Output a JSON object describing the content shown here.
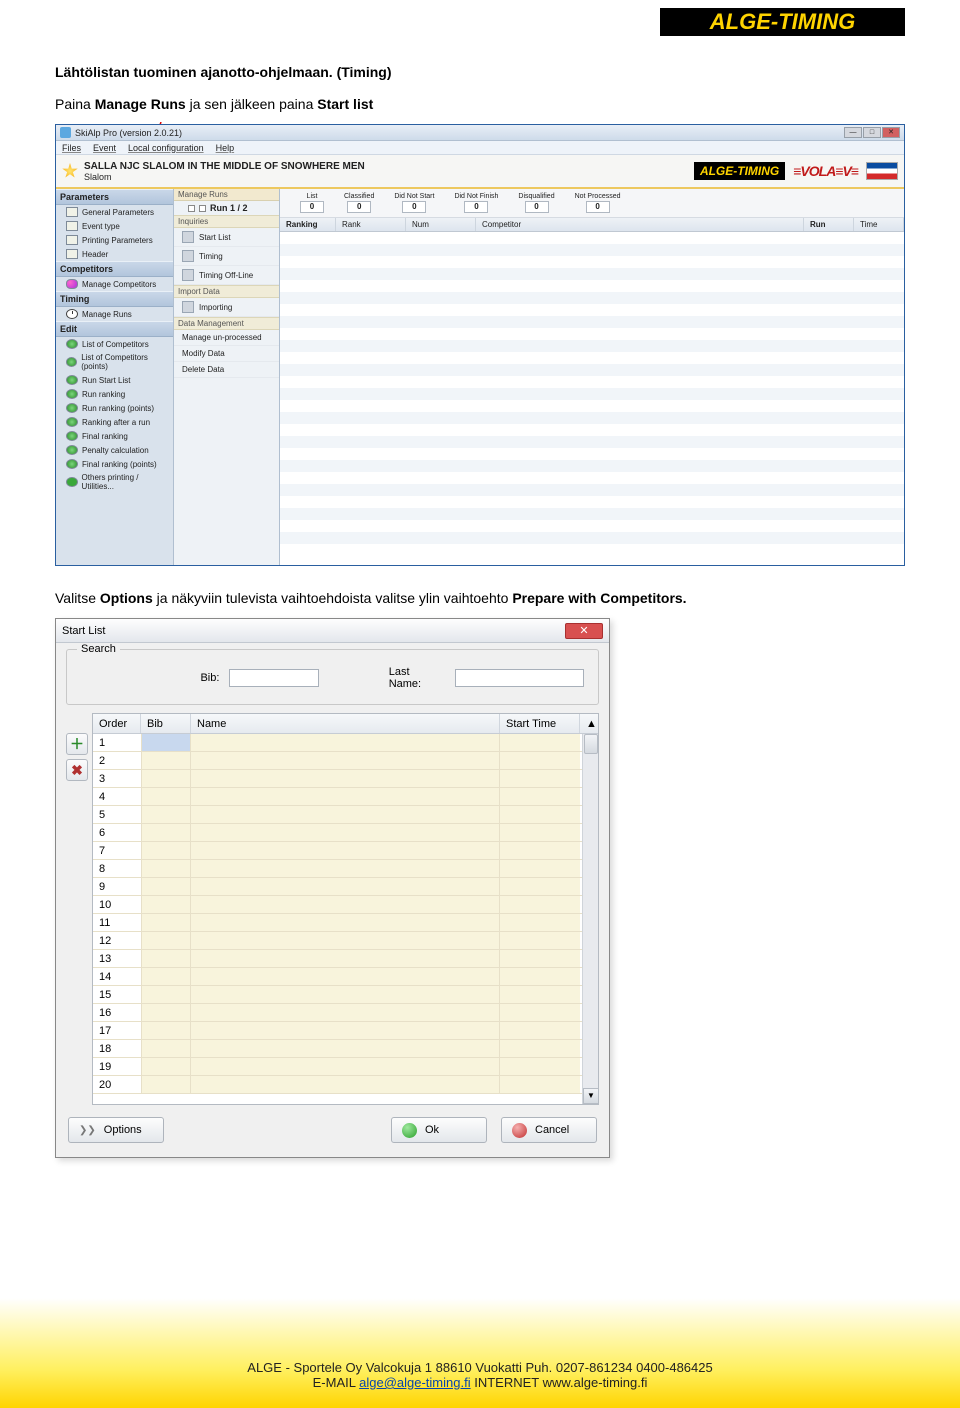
{
  "logo_text": "ALGE-TIMING",
  "heading": "Lähtölistan tuominen ajanotto-ohjelmaan. (Timing)",
  "para2_pre": "Paina ",
  "para2_b1": "Manage Runs",
  "para2_mid": " ja sen jälkeen paina ",
  "para2_b2": "Start list",
  "para3_pre": "Valitse ",
  "para3_b1": "Options",
  "para3_mid": " ja näkyviin tulevista vaihtoehdoista valitse ylin vaihtoehto ",
  "para3_b2": "Prepare with Competitors.",
  "app1": {
    "title": "SkiAlp Pro (version 2.0.21)",
    "menus": [
      "Files",
      "Event",
      "Local configuration",
      "Help"
    ],
    "event_title": "SALLA NJC SLALOM IN THE MIDDLE OF SNOWHERE MEN",
    "event_sub": "Slalom",
    "logo1": "ALGE-TIMING",
    "logo2": "≡VOLA≡V≡",
    "sidebar": {
      "parameters": "Parameters",
      "p_items": [
        "General Parameters",
        "Event type",
        "Printing Parameters",
        "Header"
      ],
      "competitors": "Competitors",
      "c_items": [
        "Manage Competitors"
      ],
      "timing": "Timing",
      "t_items": [
        "Manage Runs"
      ],
      "edit": "Edit",
      "e_items": [
        "List of Competitors",
        "List of Competitors (points)",
        "Run Start List",
        "Run ranking",
        "Run ranking (points)",
        "Ranking after a run",
        "Final ranking",
        "Penalty calculation",
        "Final ranking (points)",
        "Others printing / Utilities..."
      ]
    },
    "center": {
      "head": "Manage Runs",
      "run": "Run 1 / 2",
      "cat1": "Inquiries",
      "i1": "Start List",
      "i2": "Timing",
      "i3": "Timing Off-Line",
      "cat2": "Import Data",
      "imp": "Importing",
      "cat3": "Data Management",
      "d1": "Manage un-processed",
      "d2": "Modify Data",
      "d3": "Delete Data"
    },
    "tallies": [
      {
        "lbl": "List",
        "val": "0"
      },
      {
        "lbl": "Classified",
        "val": "0"
      },
      {
        "lbl": "Did Not Start",
        "val": "0"
      },
      {
        "lbl": "Did Not Finish",
        "val": "0"
      },
      {
        "lbl": "Disqualified",
        "val": "0"
      },
      {
        "lbl": "Not Processed",
        "val": "0"
      }
    ],
    "rank_hdr": {
      "ranking": "Ranking",
      "rank": "Rank",
      "num": "Num",
      "competitor": "Competitor",
      "run": "Run",
      "time": "Time"
    }
  },
  "dlg": {
    "title": "Start List",
    "search": "Search",
    "bib_lbl": "Bib:",
    "lastname_lbl": "Last Name:",
    "cols": {
      "order": "Order",
      "bib": "Bib",
      "name": "Name",
      "start": "Start Time"
    },
    "rows": [
      "1",
      "2",
      "3",
      "4",
      "5",
      "6",
      "7",
      "8",
      "9",
      "10",
      "11",
      "12",
      "13",
      "14",
      "15",
      "16",
      "17",
      "18",
      "19",
      "20"
    ],
    "btn_options": "Options",
    "btn_ok": "Ok",
    "btn_cancel": "Cancel"
  },
  "footer": {
    "line1a": "ALGE - Sportele Oy Valcokuja 1 88610 Vuokatti  Puh. 0207-861234  0400-486425",
    "line2a": "E-MAIL ",
    "email": "alge@alge-timing.fi",
    "line2b": "  INTERNET www.alge-timing.fi"
  }
}
